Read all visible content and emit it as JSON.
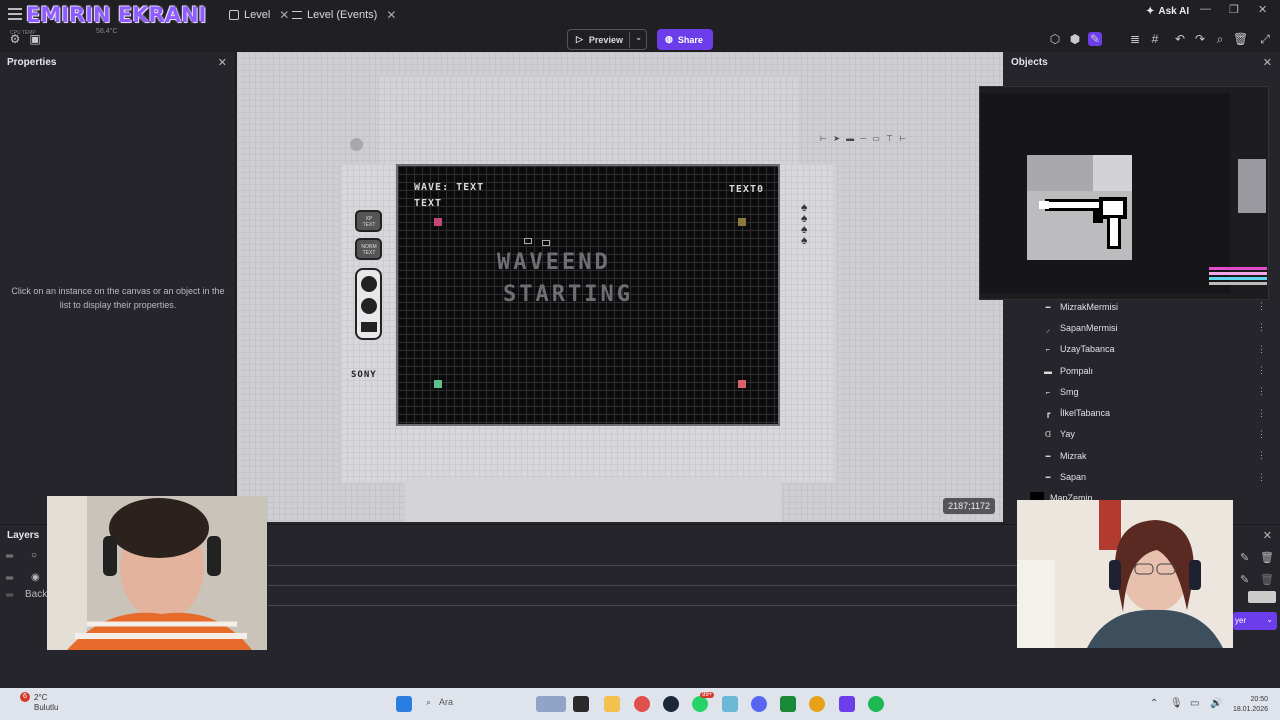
{
  "overlay": {
    "streamer_title": "EMIRIN EKRANI",
    "cpu_label": "CPU TEMP",
    "cpu_value": "58.4°C"
  },
  "tabs": [
    {
      "label": "Level"
    },
    {
      "label": "Level (Events)"
    }
  ],
  "header": {
    "ask_ai": "Ask AI"
  },
  "toolbar": {
    "preview_label": "Preview",
    "share_label": "Share"
  },
  "properties": {
    "title": "Properties",
    "hint": "Click on an instance on the canvas or an object in the list to display their properties."
  },
  "canvas": {
    "coords": "2187;1172",
    "game": {
      "wave_text": "WAVE: TEXT",
      "text_label": "TEXT",
      "right_label": "TEXT0",
      "banner_line1": "WAVEEND",
      "banner_line2": "STARTING",
      "sony": "SONY",
      "pad_text_1": "XP TEXT",
      "pad_text_2": "NORM TEXT"
    },
    "colors": {
      "pink": "#c2487a",
      "gold": "#8d7a3a",
      "green": "#5fbf8d",
      "red": "#d9626a"
    }
  },
  "objects": {
    "title": "Objects",
    "items": [
      {
        "label": "MizrakMermisi",
        "icon": "line-icon"
      },
      {
        "label": "SapanMermisi",
        "icon": "sling-icon"
      },
      {
        "label": "UzayTabanca",
        "icon": "pistol-icon"
      },
      {
        "label": "Pompalı",
        "icon": "shotgun-icon"
      },
      {
        "label": "Smg",
        "icon": "smg-icon"
      },
      {
        "label": "İlkelTabanca",
        "icon": "pistol-icon"
      },
      {
        "label": "Yay",
        "icon": "bow-icon"
      },
      {
        "label": "Mizrak",
        "icon": "spear-icon"
      },
      {
        "label": "Sapan",
        "icon": "sling-icon"
      },
      {
        "label": "MapZemin",
        "icon": "square-icon"
      }
    ]
  },
  "layers": {
    "title": "Layers",
    "back_label": "Back",
    "add_layer": "yer"
  },
  "taskbar": {
    "weather_temp": "2°C",
    "weather_desc": "Bulutlu",
    "weather_badge": "6",
    "search": "Ara",
    "time": "20:50",
    "date": "18.01.2026",
    "badge_count": "99+"
  }
}
